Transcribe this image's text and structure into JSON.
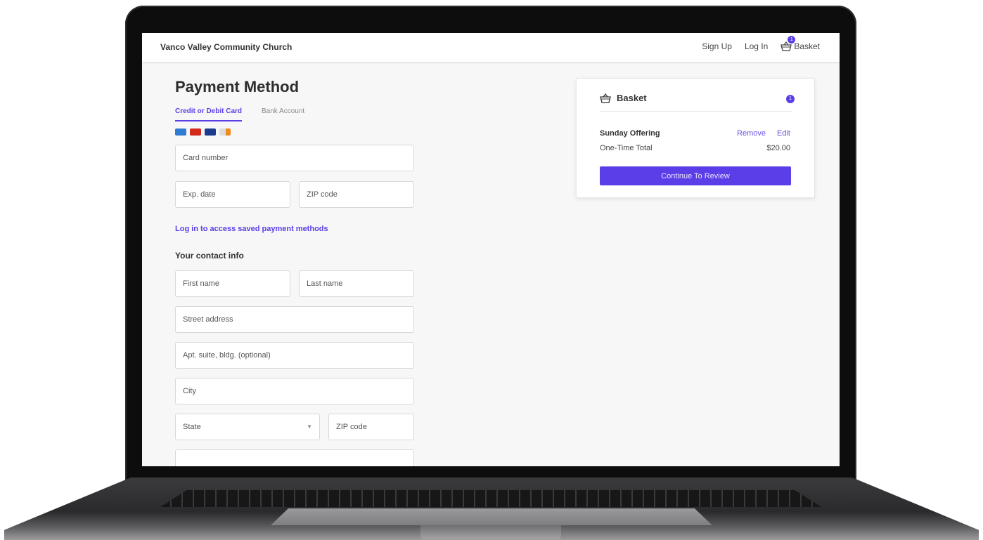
{
  "header": {
    "brand": "Vanco Valley Community Church",
    "sign_up": "Sign Up",
    "log_in": "Log In",
    "basket_label": "Basket",
    "basket_count": "1"
  },
  "payment": {
    "title": "Payment Method",
    "tabs": [
      {
        "label": "Credit or Debit Card",
        "active": true
      },
      {
        "label": "Bank Account",
        "active": false
      }
    ],
    "card_icons": [
      "amex-card-icon",
      "mastercard-icon",
      "visa-card-icon",
      "discover-card-icon"
    ],
    "card_number_placeholder": "Card number",
    "exp_date_placeholder": "Exp. date",
    "zip_placeholder": "ZIP code",
    "login_link": "Log in to access saved payment methods"
  },
  "contact": {
    "heading": "Your contact info",
    "first_name": "First name",
    "last_name": "Last name",
    "street": "Street address",
    "apt": "Apt. suite, bldg. (optional)",
    "city": "City",
    "state": "State",
    "zip": "ZIP code"
  },
  "basket": {
    "title": "Basket",
    "count": "1",
    "item_name": "Sunday Offering",
    "remove": "Remove",
    "edit": "Edit",
    "total_label": "One-Time Total",
    "total_value": "$20.00",
    "cta": "Continue To Review"
  },
  "colors": {
    "accent": "#5b3ee8",
    "background": "#f7f7f7"
  }
}
